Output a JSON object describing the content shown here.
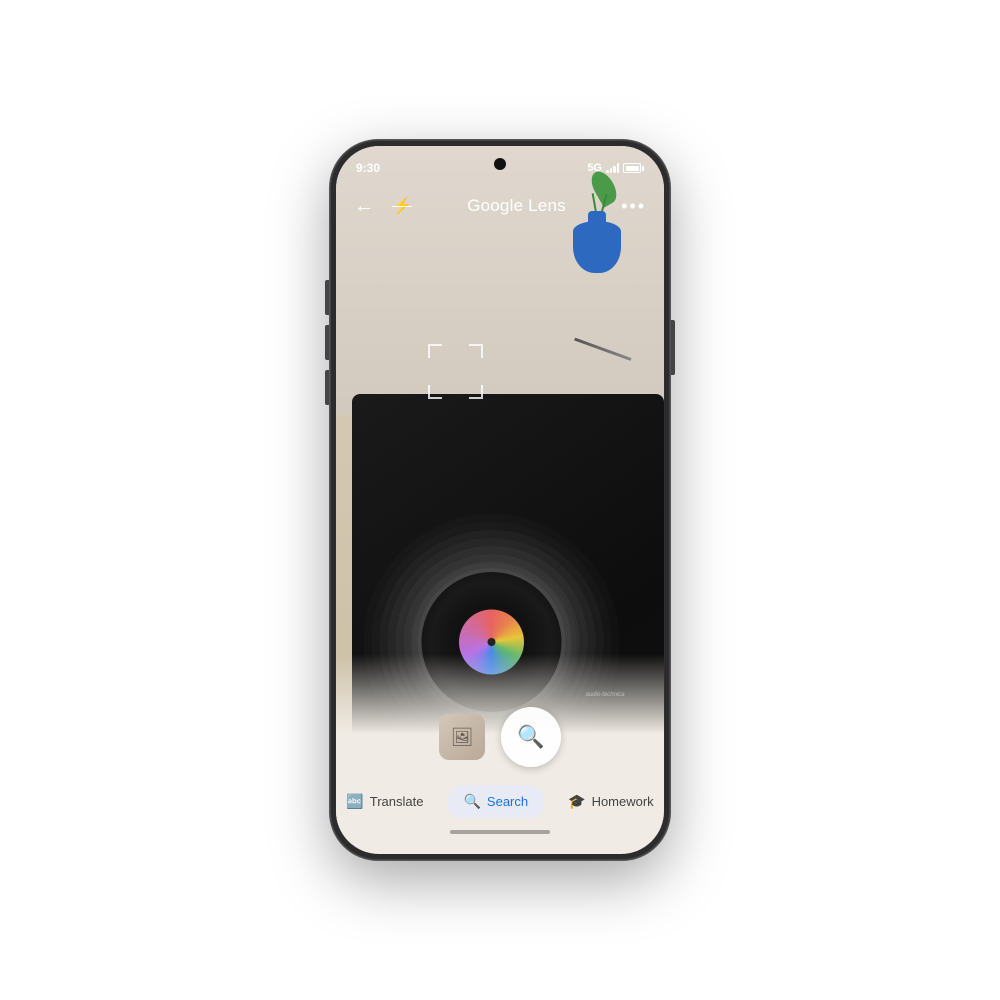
{
  "phone": {
    "status_bar": {
      "time": "9:30",
      "signal": "5G",
      "battery_full": true
    },
    "lens_bar": {
      "title": "Google Lens",
      "back_icon": "←",
      "flash_off_icon": "⚡",
      "more_icon": "···"
    },
    "camera": {
      "brand_text": "audio-technica"
    },
    "bottom_panel": {
      "tabs": [
        {
          "id": "translate",
          "label": "Translate",
          "icon": "🔤",
          "active": false
        },
        {
          "id": "search",
          "label": "Search",
          "icon": "🔍",
          "active": true
        },
        {
          "id": "homework",
          "label": "Homework",
          "icon": "🎓",
          "active": false
        }
      ],
      "shutter_label": "Search"
    },
    "home_indicator": true
  }
}
